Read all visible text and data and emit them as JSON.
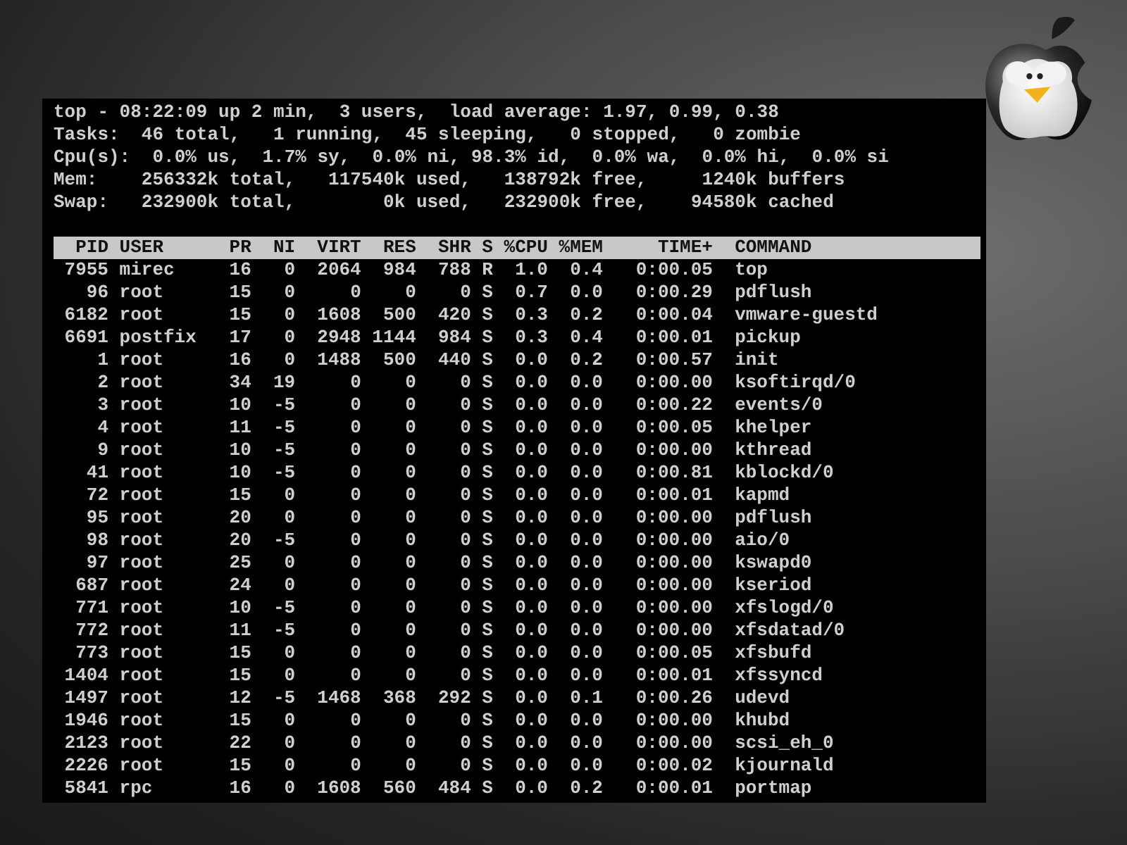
{
  "summary_lines": [
    "top - 08:22:09 up 2 min,  3 users,  load average: 1.97, 0.99, 0.38",
    "Tasks:  46 total,   1 running,  45 sleeping,   0 stopped,   0 zombie",
    "Cpu(s):  0.0% us,  1.7% sy,  0.0% ni, 98.3% id,  0.0% wa,  0.0% hi,  0.0% si",
    "Mem:    256332k total,   117540k used,   138792k free,     1240k buffers",
    "Swap:   232900k total,        0k used,   232900k free,    94580k cached"
  ],
  "table": {
    "columns": [
      "PID",
      "USER",
      "PR",
      "NI",
      "VIRT",
      "RES",
      "SHR",
      "S",
      "%CPU",
      "%MEM",
      "TIME+",
      "COMMAND"
    ],
    "rows": [
      [
        "7955",
        "mirec",
        "16",
        "0",
        "2064",
        "984",
        "788",
        "R",
        "1.0",
        "0.4",
        "0:00.05",
        "top"
      ],
      [
        "96",
        "root",
        "15",
        "0",
        "0",
        "0",
        "0",
        "S",
        "0.7",
        "0.0",
        "0:00.29",
        "pdflush"
      ],
      [
        "6182",
        "root",
        "15",
        "0",
        "1608",
        "500",
        "420",
        "S",
        "0.3",
        "0.2",
        "0:00.04",
        "vmware-guestd"
      ],
      [
        "6691",
        "postfix",
        "17",
        "0",
        "2948",
        "1144",
        "984",
        "S",
        "0.3",
        "0.4",
        "0:00.01",
        "pickup"
      ],
      [
        "1",
        "root",
        "16",
        "0",
        "1488",
        "500",
        "440",
        "S",
        "0.0",
        "0.2",
        "0:00.57",
        "init"
      ],
      [
        "2",
        "root",
        "34",
        "19",
        "0",
        "0",
        "0",
        "S",
        "0.0",
        "0.0",
        "0:00.00",
        "ksoftirqd/0"
      ],
      [
        "3",
        "root",
        "10",
        "-5",
        "0",
        "0",
        "0",
        "S",
        "0.0",
        "0.0",
        "0:00.22",
        "events/0"
      ],
      [
        "4",
        "root",
        "11",
        "-5",
        "0",
        "0",
        "0",
        "S",
        "0.0",
        "0.0",
        "0:00.05",
        "khelper"
      ],
      [
        "9",
        "root",
        "10",
        "-5",
        "0",
        "0",
        "0",
        "S",
        "0.0",
        "0.0",
        "0:00.00",
        "kthread"
      ],
      [
        "41",
        "root",
        "10",
        "-5",
        "0",
        "0",
        "0",
        "S",
        "0.0",
        "0.0",
        "0:00.81",
        "kblockd/0"
      ],
      [
        "72",
        "root",
        "15",
        "0",
        "0",
        "0",
        "0",
        "S",
        "0.0",
        "0.0",
        "0:00.01",
        "kapmd"
      ],
      [
        "95",
        "root",
        "20",
        "0",
        "0",
        "0",
        "0",
        "S",
        "0.0",
        "0.0",
        "0:00.00",
        "pdflush"
      ],
      [
        "98",
        "root",
        "20",
        "-5",
        "0",
        "0",
        "0",
        "S",
        "0.0",
        "0.0",
        "0:00.00",
        "aio/0"
      ],
      [
        "97",
        "root",
        "25",
        "0",
        "0",
        "0",
        "0",
        "S",
        "0.0",
        "0.0",
        "0:00.00",
        "kswapd0"
      ],
      [
        "687",
        "root",
        "24",
        "0",
        "0",
        "0",
        "0",
        "S",
        "0.0",
        "0.0",
        "0:00.00",
        "kseriod"
      ],
      [
        "771",
        "root",
        "10",
        "-5",
        "0",
        "0",
        "0",
        "S",
        "0.0",
        "0.0",
        "0:00.00",
        "xfslogd/0"
      ],
      [
        "772",
        "root",
        "11",
        "-5",
        "0",
        "0",
        "0",
        "S",
        "0.0",
        "0.0",
        "0:00.00",
        "xfsdatad/0"
      ],
      [
        "773",
        "root",
        "15",
        "0",
        "0",
        "0",
        "0",
        "S",
        "0.0",
        "0.0",
        "0:00.05",
        "xfsbufd"
      ],
      [
        "1404",
        "root",
        "15",
        "0",
        "0",
        "0",
        "0",
        "S",
        "0.0",
        "0.0",
        "0:00.01",
        "xfssyncd"
      ],
      [
        "1497",
        "root",
        "12",
        "-5",
        "1468",
        "368",
        "292",
        "S",
        "0.0",
        "0.1",
        "0:00.26",
        "udevd"
      ],
      [
        "1946",
        "root",
        "15",
        "0",
        "0",
        "0",
        "0",
        "S",
        "0.0",
        "0.0",
        "0:00.00",
        "khubd"
      ],
      [
        "2123",
        "root",
        "22",
        "0",
        "0",
        "0",
        "0",
        "S",
        "0.0",
        "0.0",
        "0:00.00",
        "scsi_eh_0"
      ],
      [
        "2226",
        "root",
        "15",
        "0",
        "0",
        "0",
        "0",
        "S",
        "0.0",
        "0.0",
        "0:00.02",
        "kjournald"
      ],
      [
        "5841",
        "rpc",
        "16",
        "0",
        "1608",
        "560",
        "484",
        "S",
        "0.0",
        "0.2",
        "0:00.01",
        "portmap"
      ]
    ]
  }
}
